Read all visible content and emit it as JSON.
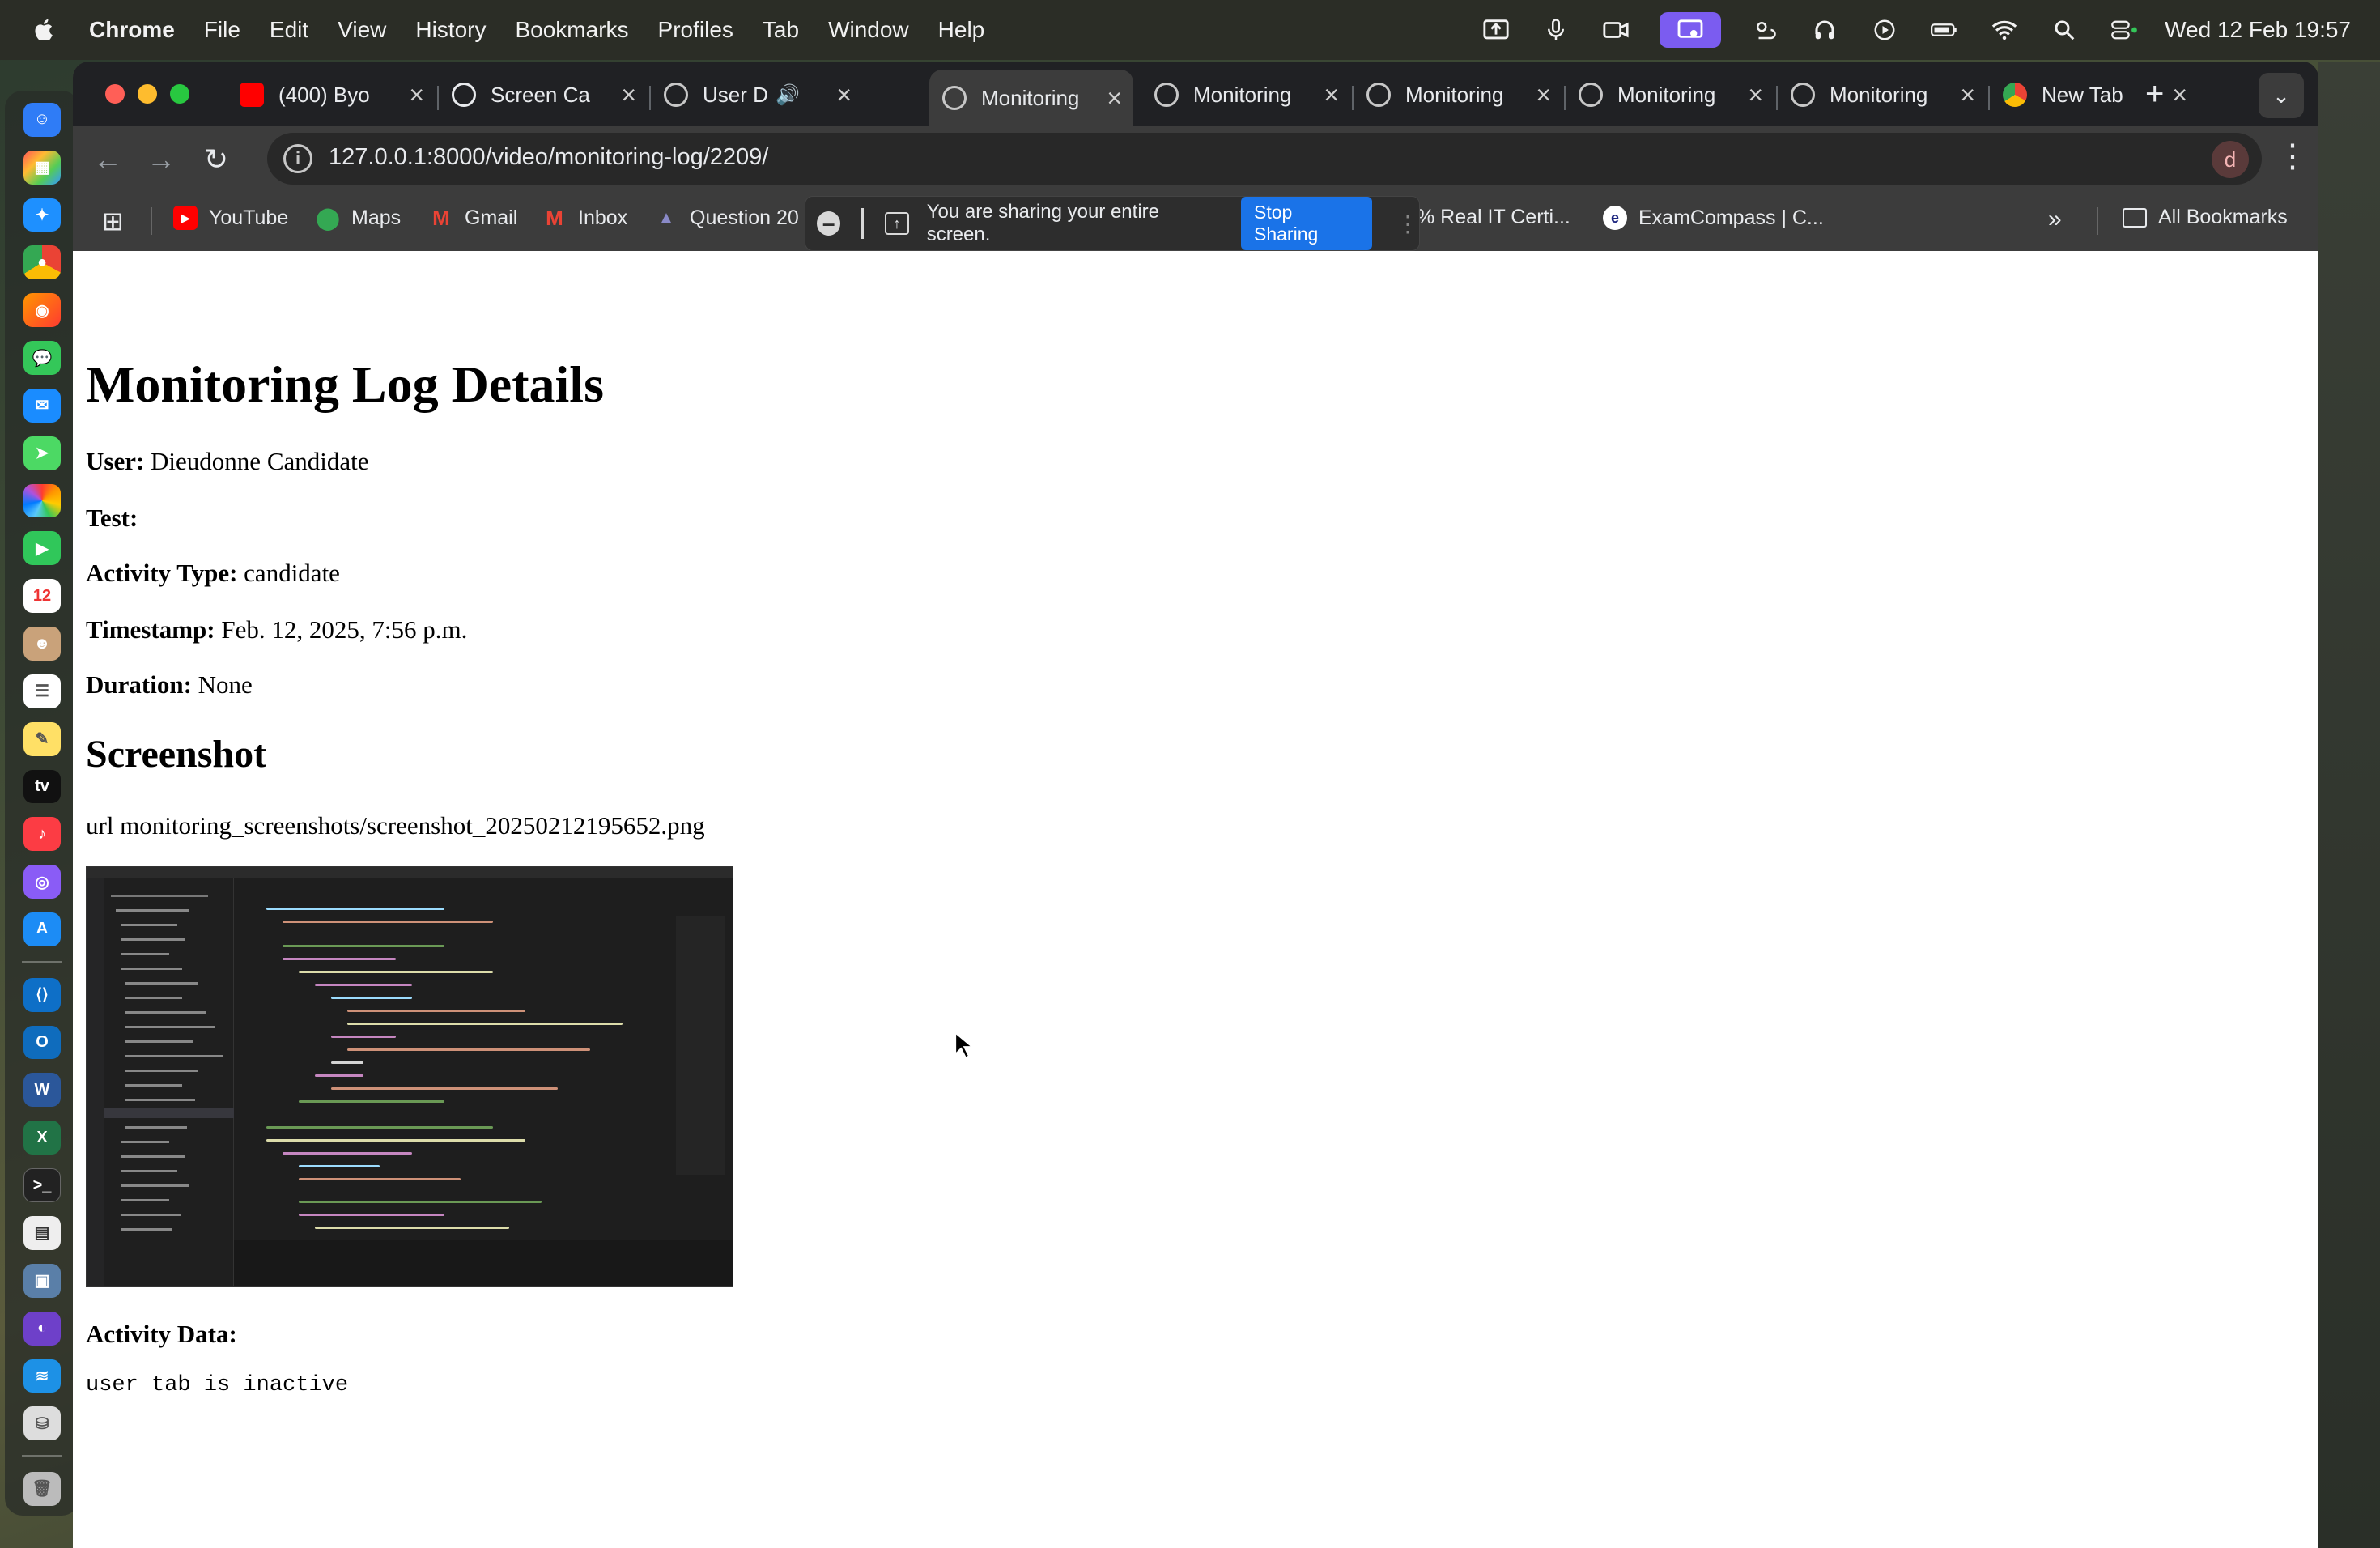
{
  "menubar": {
    "app_name": "Chrome",
    "items": [
      "File",
      "Edit",
      "View",
      "History",
      "Bookmarks",
      "Profiles",
      "Tab",
      "Window",
      "Help"
    ],
    "clock": "Wed 12 Feb  19:57"
  },
  "tabs": [
    {
      "title": "(400) Byo",
      "favicon": "youtube-icon",
      "color": "#ff0000"
    },
    {
      "title": "Screen Ca",
      "favicon": "openai-icon",
      "color": "#e8eaed"
    },
    {
      "title": "User D",
      "favicon": "globe-icon",
      "color": "#c7c7c7"
    },
    {
      "title": "Monitoring",
      "favicon": "globe-icon",
      "color": "#c7c7c7"
    },
    {
      "title": "Monitoring",
      "favicon": "globe-icon",
      "color": "#c7c7c7"
    },
    {
      "title": "Monitoring",
      "favicon": "globe-icon",
      "color": "#c7c7c7"
    },
    {
      "title": "Monitoring",
      "favicon": "globe-icon",
      "color": "#c7c7c7"
    },
    {
      "title": "Monitoring",
      "favicon": "globe-icon",
      "color": "#c7c7c7"
    },
    {
      "title": "New Tab",
      "favicon": "chrome-icon",
      "color": "#c7c7c7"
    }
  ],
  "omnibox": {
    "url": "127.0.0.1:8000/video/monitoring-log/2209/"
  },
  "profile_initial": "d",
  "bookmarks": {
    "items": [
      {
        "label": "YouTube",
        "icon": "youtube-icon"
      },
      {
        "label": "Maps",
        "icon": "maps-icon"
      },
      {
        "label": "Gmail",
        "icon": "gmail-icon"
      },
      {
        "label": "Inbox",
        "icon": "gmail-icon"
      },
      {
        "label": "Question 20",
        "icon": "question-icon"
      },
      {
        "label": "% Real IT Certi...",
        "icon": ""
      },
      {
        "label": "ExamCompass | C...",
        "icon": "examcompass-icon"
      }
    ],
    "all_bookmarks": "All Bookmarks"
  },
  "share_banner": {
    "message": "You are sharing your entire screen.",
    "stop_label": "Stop Sharing"
  },
  "page": {
    "title": "Monitoring Log Details",
    "fields": [
      {
        "label": "User:",
        "value": "Dieudonne Candidate"
      },
      {
        "label": "Test:",
        "value": ""
      },
      {
        "label": "Activity Type:",
        "value": "candidate"
      },
      {
        "label": "Timestamp:",
        "value": "Feb. 12, 2025, 7:56 p.m."
      },
      {
        "label": "Duration:",
        "value": "None"
      }
    ],
    "screenshot_heading": "Screenshot",
    "screenshot_url": "url monitoring_screenshots/screenshot_20250212195652.png",
    "activity_label": "Activity Data:",
    "activity_data": "user tab is inactive"
  }
}
